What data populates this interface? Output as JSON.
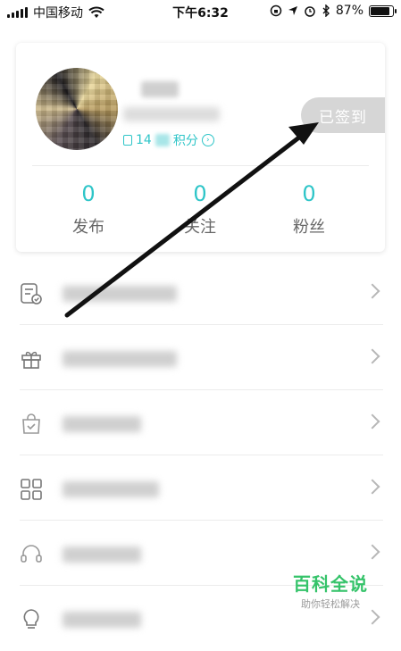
{
  "status_bar": {
    "carrier": "中国移动",
    "time": "下午6:32",
    "battery_percent": "87%",
    "battery_level": 0.87
  },
  "profile": {
    "points_suffix": "积分",
    "points_prefix_visible": "14",
    "sign_in_status": "已签到"
  },
  "stats": [
    {
      "count": "0",
      "label": "发布"
    },
    {
      "count": "0",
      "label": "关注"
    },
    {
      "count": "0",
      "label": "粉丝"
    }
  ],
  "menu": {
    "items": [
      {
        "icon": "document-check-icon"
      },
      {
        "icon": "gift-icon"
      },
      {
        "icon": "shopping-bag-icon"
      },
      {
        "icon": "grid-apps-icon"
      },
      {
        "icon": "headset-icon"
      },
      {
        "icon": "lightbulb-icon"
      }
    ]
  },
  "watermark": {
    "title": "百科全说",
    "subtitle": "助你轻松解决"
  },
  "colors": {
    "accent": "#2ec5c8",
    "signed_bg": "#d6d6d6",
    "watermark": "#35c36a"
  }
}
